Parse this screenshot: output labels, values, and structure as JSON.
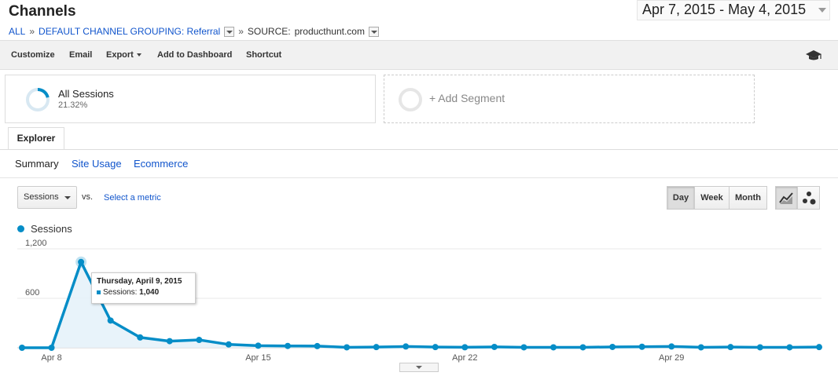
{
  "header": {
    "title": "Channels",
    "date_range": "Apr 7, 2015 - May 4, 2015",
    "breadcrumb": {
      "all": "ALL",
      "sep1": "»",
      "grouping": "DEFAULT CHANNEL GROUPING: Referral",
      "sep2": "»",
      "source_label": "SOURCE:",
      "source_value": "producthunt.com"
    }
  },
  "toolbar": {
    "customize": "Customize",
    "email": "Email",
    "export": "Export",
    "add_to_dashboard": "Add to Dashboard",
    "shortcut": "Shortcut",
    "icon": "graduation-cap-icon"
  },
  "segments": {
    "active": {
      "name": "All Sessions",
      "pct": "21.32%",
      "ring_fraction": 0.2132
    },
    "add_label": "+ Add Segment"
  },
  "tabs": {
    "explorer": "Explorer"
  },
  "subnav": {
    "summary": "Summary",
    "site_usage": "Site Usage",
    "ecommerce": "Ecommerce"
  },
  "controls": {
    "metric": "Sessions",
    "vs": "vs.",
    "select_metric": "Select a metric",
    "day": "Day",
    "week": "Week",
    "month": "Month",
    "active_period": "Day",
    "line_icon": "line-chart-icon",
    "motion_icon": "motion-chart-icon"
  },
  "colors": {
    "series": "#058dc7",
    "fill": "#e6f2f9",
    "link": "#1155cc"
  },
  "tooltip": {
    "title": "Thursday, April 9, 2015",
    "label": "Sessions:",
    "value": "1,040"
  },
  "chart_data": {
    "type": "line",
    "legend": "Sessions",
    "y_ticks": [
      "1,200",
      "600"
    ],
    "x_ticks": [
      "Apr 8",
      "Apr 15",
      "Apr 22",
      "Apr 29"
    ],
    "ylim": [
      0,
      1200
    ],
    "x": [
      "2015-04-07",
      "2015-04-08",
      "2015-04-09",
      "2015-04-10",
      "2015-04-11",
      "2015-04-12",
      "2015-04-13",
      "2015-04-14",
      "2015-04-15",
      "2015-04-16",
      "2015-04-17",
      "2015-04-18",
      "2015-04-19",
      "2015-04-20",
      "2015-04-21",
      "2015-04-22",
      "2015-04-23",
      "2015-04-24",
      "2015-04-25",
      "2015-04-26",
      "2015-04-27",
      "2015-04-28",
      "2015-04-29",
      "2015-04-30",
      "2015-05-01",
      "2015-05-02",
      "2015-05-03",
      "2015-05-04"
    ],
    "series": [
      {
        "name": "Sessions",
        "values": [
          0,
          0,
          1040,
          330,
          125,
          80,
          95,
          40,
          25,
          22,
          20,
          5,
          8,
          15,
          8,
          6,
          10,
          5,
          5,
          5,
          10,
          12,
          15,
          5,
          8,
          5,
          5,
          8
        ],
        "highlight_index": 2
      }
    ]
  }
}
